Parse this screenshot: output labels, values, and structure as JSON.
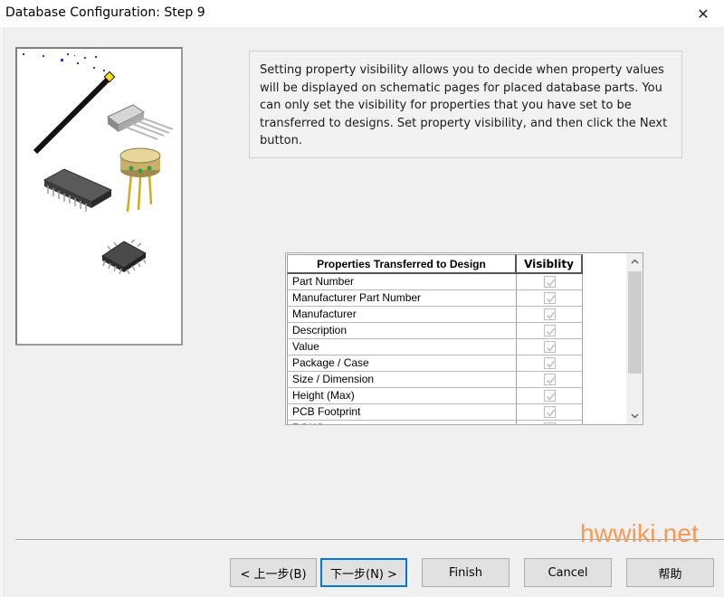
{
  "window": {
    "title": "Database Configuration: Step 9",
    "close_glyph": "✕"
  },
  "description": "Setting property visibility allows you to decide when property values will be displayed on schematic pages for placed database parts. You can only set the visibility for properties that you have set to be transferred to designs. Set property visibility, and then click the Next button.",
  "grid": {
    "headers": {
      "name": "Properties Transferred to Design",
      "visibility": "Visiblity"
    },
    "rows": [
      {
        "name": "Part Number",
        "checked": true
      },
      {
        "name": "Manufacturer Part Number",
        "checked": true
      },
      {
        "name": "Manufacturer",
        "checked": true
      },
      {
        "name": "Description",
        "checked": true
      },
      {
        "name": "Value",
        "checked": true
      },
      {
        "name": "Package / Case",
        "checked": true
      },
      {
        "name": "Size / Dimension",
        "checked": true
      },
      {
        "name": "Height (Max)",
        "checked": true
      },
      {
        "name": "PCB Footprint",
        "checked": true
      },
      {
        "name": "ROHS",
        "checked": true
      }
    ],
    "scroll_up_icon": "chevron-up-icon",
    "scroll_down_icon": "chevron-down-icon"
  },
  "buttons": {
    "back": "< 上一步(B)",
    "next": "下一步(N) >",
    "finish": "Finish",
    "cancel": "Cancel",
    "help": "帮助"
  },
  "watermark": "hwwiki.net",
  "colors": {
    "default_button_border": "#0078d7",
    "watermark": "#f39a55",
    "checkmark": "#c4c4c4"
  }
}
